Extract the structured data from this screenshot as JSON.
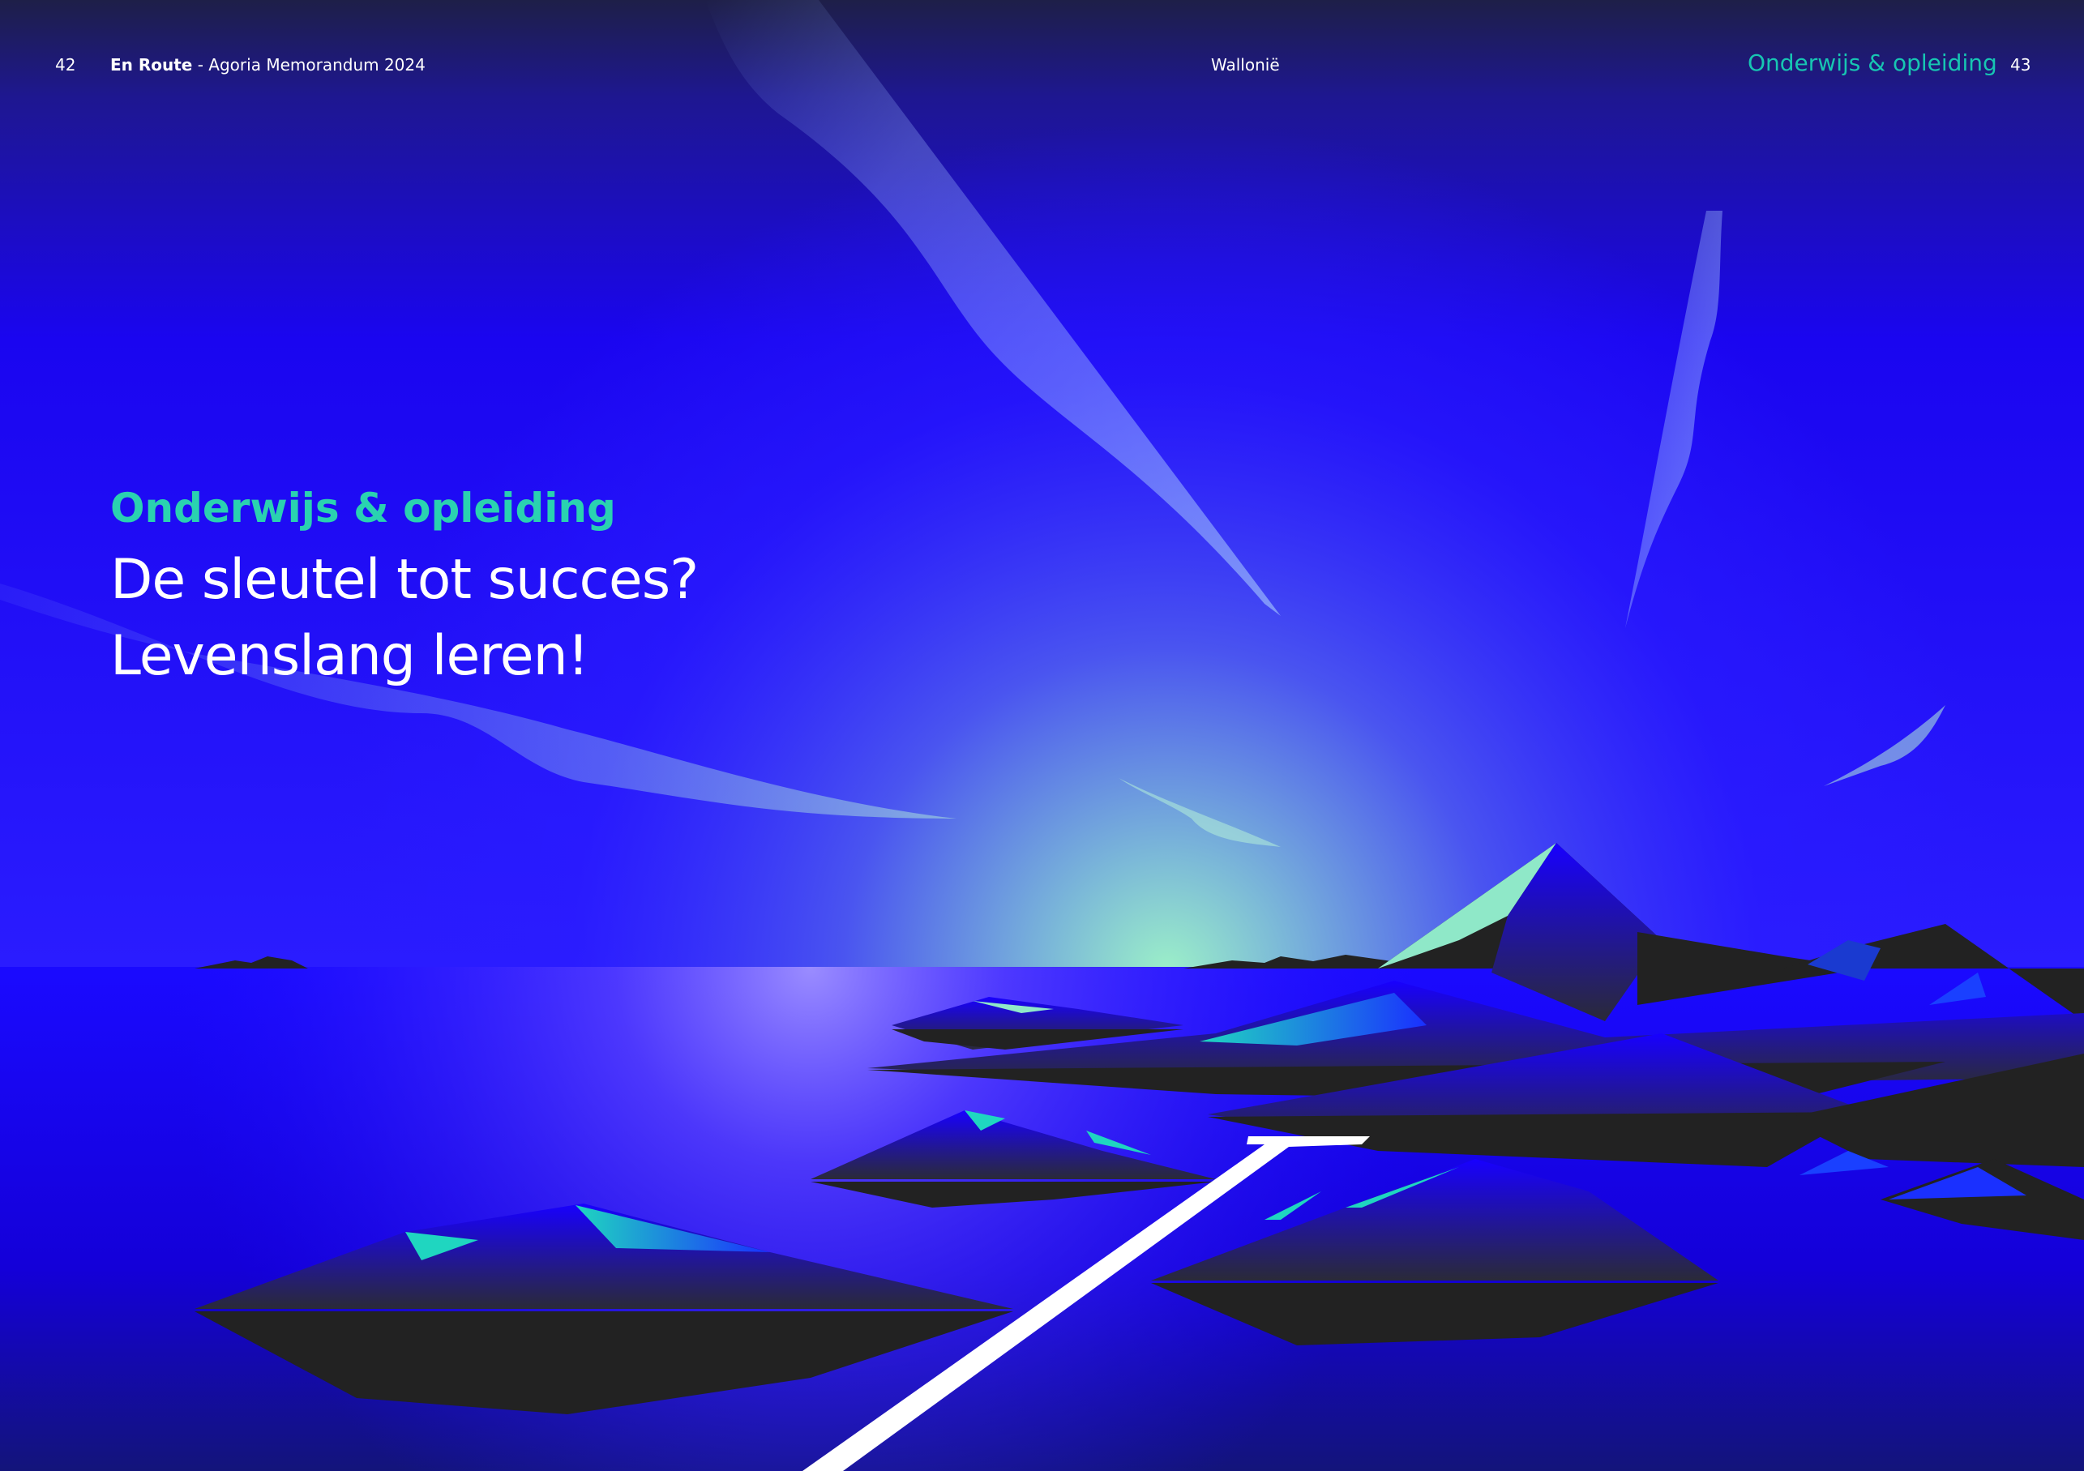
{
  "header": {
    "page_left": "42",
    "publication_title": "En Route",
    "publication_subtitle": " - Agoria Memorandum 2024",
    "region": "Wallonië",
    "section": "Onderwijs & opleiding",
    "page_right": "43"
  },
  "hero": {
    "kicker": "Onderwijs & opleiding",
    "headline_line1": "De sleutel tot succes?",
    "headline_line2": "Levenslang leren!"
  },
  "colors": {
    "sky_top": "#1e1f4a",
    "sky_blue": "#1a00ff",
    "horizon_glow": "#8fe8c8",
    "water": "#1200e8",
    "teal_accent": "#17c6b2",
    "kicker_green": "#2ad2b0",
    "rock_dark": "#222222"
  }
}
